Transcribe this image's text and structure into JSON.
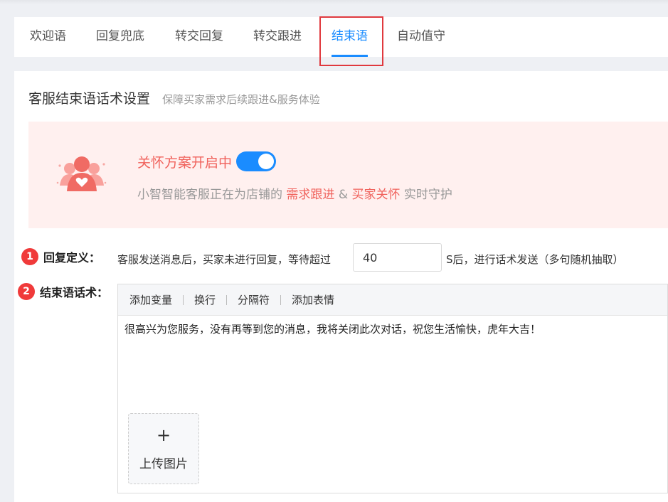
{
  "tabs": [
    {
      "label": "欢迎语",
      "active": false
    },
    {
      "label": "回复兜底",
      "active": false
    },
    {
      "label": "转交回复",
      "active": false
    },
    {
      "label": "转交跟进",
      "active": false
    },
    {
      "label": "结束语",
      "active": true
    },
    {
      "label": "自动值守",
      "active": false
    }
  ],
  "card": {
    "title": "客服结束语话术设置",
    "subtitle": "保障买家需求后续跟进&服务体验"
  },
  "banner": {
    "care_title": "关怀方案开启中",
    "toggle_on": true,
    "line_prefix": "小智智能客服正在为店铺的",
    "highlight1": "需求跟进",
    "amp": "&",
    "highlight2": "买家关怀",
    "line_suffix": "实时守护",
    "icon": "users-heart-icon"
  },
  "reply_def": {
    "number": "1",
    "label": "回复定义：",
    "text": "客服发送消息后，买家未进行回复，等待超过",
    "wait_value": "40",
    "tail": "S后，进行话术发送（多句随机抽取）"
  },
  "closing": {
    "number": "2",
    "label": "结束语话术：",
    "toolbar": [
      "添加变量",
      "换行",
      "分隔符",
      "添加表情"
    ],
    "content": "很高兴为您服务，没有再等到您的消息，我将关闭此次对话，祝您生活愉快，虎年大吉！",
    "upload_plus": "+",
    "upload_label": "上传图片"
  },
  "colors": {
    "accent": "#1a8cff",
    "care": "#f0625c",
    "badge": "#f03a3a",
    "banner_bg": "#fff0ef"
  }
}
